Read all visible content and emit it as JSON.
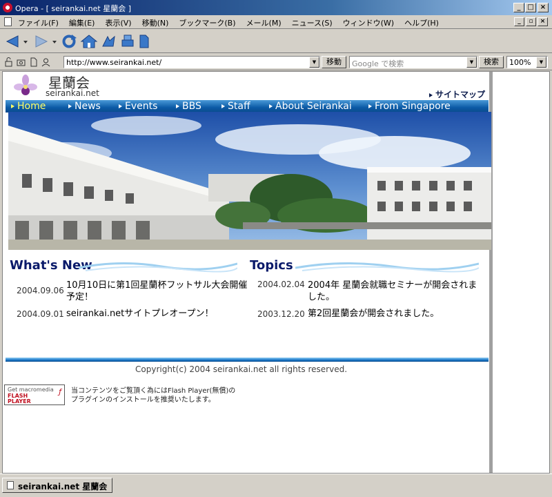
{
  "window": {
    "title": "Opera - [ seirankai.net 星蘭会 ]",
    "controls": [
      "_",
      "□",
      "×"
    ]
  },
  "menubar": {
    "items": [
      "ファイル(F)",
      "編集(E)",
      "表示(V)",
      "移動(N)",
      "ブックマーク(B)",
      "メール(M)",
      "ニュース(S)",
      "ウィンドウ(W)",
      "ヘルプ(H)"
    ]
  },
  "address": {
    "url": "http://www.seirankai.net/",
    "go_label": "移動",
    "search_placeholder": "Google で検索",
    "search_label": "検索",
    "zoom": "100%"
  },
  "site": {
    "name": "星蘭会",
    "domain": "seirankai.net",
    "sitemap": "サイトマップ",
    "nav": [
      "Home",
      "News",
      "Events",
      "BBS",
      "Staff",
      "About Seirankai",
      "From Singapore"
    ],
    "active_nav": "Home"
  },
  "whats_new": {
    "title": "What's New",
    "items": [
      {
        "date": "2004.09.06",
        "text": "10月10日に第1回星蘭杯フットサル大会開催予定！"
      },
      {
        "date": "2004.09.01",
        "text": "seirankai.netサイトプレオープン！"
      }
    ]
  },
  "topics": {
    "title": "Topics",
    "items": [
      {
        "date": "2004.02.04",
        "text": "2004年 星蘭会就職セミナーが開会されました。"
      },
      {
        "date": "2003.12.20",
        "text": "第2回星蘭会が開会されました。"
      }
    ]
  },
  "footer": {
    "copyright": "Copyright(c) 2004 seirankai.net all rights reserved.",
    "flash_badge": {
      "line1": "Get macromedia",
      "line2": "FLASH",
      "line3": "PLAYER"
    },
    "flash_note_1": "当コンテンツをご覧頂く為にはFlash Player(無償)の",
    "flash_note_2": "プラグインのインストールを推奨いたします。"
  },
  "statusbar": {
    "tab_label": "seirankai.net 星蘭会"
  },
  "colors": {
    "nav_blue": "#0c5aa6",
    "heading_navy": "#0a1a6a",
    "active_nav": "#ffff66"
  }
}
